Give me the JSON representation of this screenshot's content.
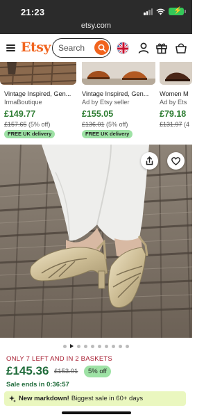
{
  "status_bar": {
    "time": "21:23",
    "url": "etsy.com"
  },
  "header": {
    "logo": "Etsy",
    "search_placeholder": "Search"
  },
  "strip_items": [
    {
      "title": "Vintage Inspired, Gen...",
      "seller": "IrmaBoutique",
      "price": "£149.77",
      "original": "£157.65",
      "discount": " (5% off)",
      "badge": "FREE UK delivery"
    },
    {
      "title": "Vintage Inspired, Gen...",
      "seller": "Ad by Etsy seller",
      "price": "£155.05",
      "original": "£136.01",
      "discount": " (5% off)",
      "badge": "FREE UK delivery"
    },
    {
      "title": "Women M",
      "seller": "Ad by Ets",
      "price": "£79.18",
      "original": "£131.97",
      "discount": " (4"
    }
  ],
  "carousel": {
    "total_images": 10,
    "current_index": 1
  },
  "product": {
    "stock_notice": "ONLY 7 LEFT AND IN 2 BASKETS",
    "price": "£145.36",
    "original_price": "£153.01",
    "discount": "5% off",
    "sale_ends": "Sale ends in 0:36:57"
  },
  "banner": {
    "label": "New markdown!",
    "text": "Biggest sale in 60+ days"
  },
  "colors": {
    "brand": "#f1641e",
    "price_green": "#2e7d32",
    "badge_green": "#9ee2a5",
    "stock_red": "#a61a2e",
    "banner_bg": "#eaf7bf"
  }
}
